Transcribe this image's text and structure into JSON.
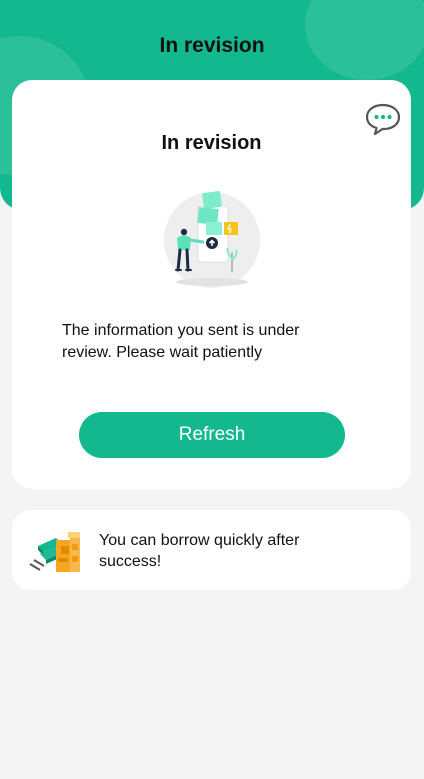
{
  "header": {
    "title": "In revision"
  },
  "card": {
    "title": "In revision",
    "message": "The information you sent is under review. Please wait patiently",
    "refresh_label": "Refresh",
    "chat_icon": "chat-bubble-icon",
    "illustration": "review-illustration"
  },
  "promo": {
    "text": "You can borrow quickly after success!",
    "icon": "money-stack-icon"
  },
  "colors": {
    "accent": "#13b88f",
    "background": "#f4f4f4",
    "card": "#ffffff",
    "text": "#111111"
  }
}
